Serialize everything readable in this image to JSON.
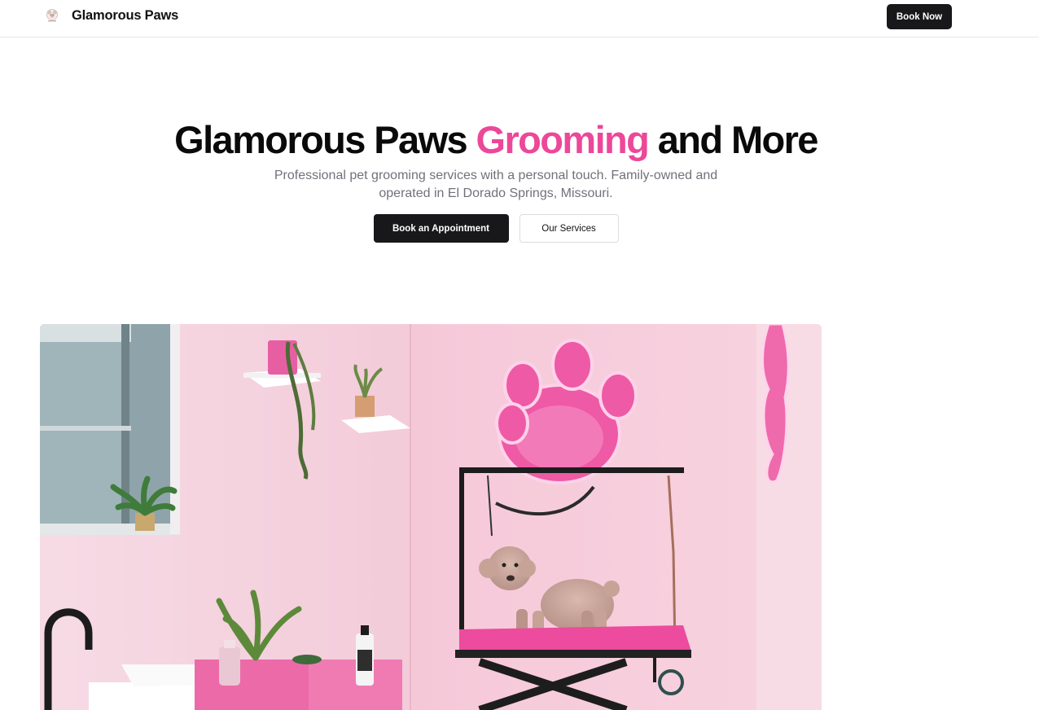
{
  "brand": {
    "name": "Glamorous Paws",
    "logo_icon": "poodle-logo-icon"
  },
  "nav": {
    "book_now_label": "Book Now"
  },
  "hero": {
    "title_before": "Glamorous Paws ",
    "title_accent": "Grooming",
    "title_after": " and More",
    "subtitle": "Professional pet grooming services with a personal touch. Family-owned and operated in El Dorado Springs, Missouri.",
    "primary_cta": "Book an Appointment",
    "secondary_cta": "Our Services"
  },
  "colors": {
    "accent": "#ec4899",
    "button_dark": "#18181b",
    "muted_text": "#71717a"
  },
  "hero_image": {
    "subject": "poodle on pink grooming table in pink salon with neon paw sign"
  }
}
